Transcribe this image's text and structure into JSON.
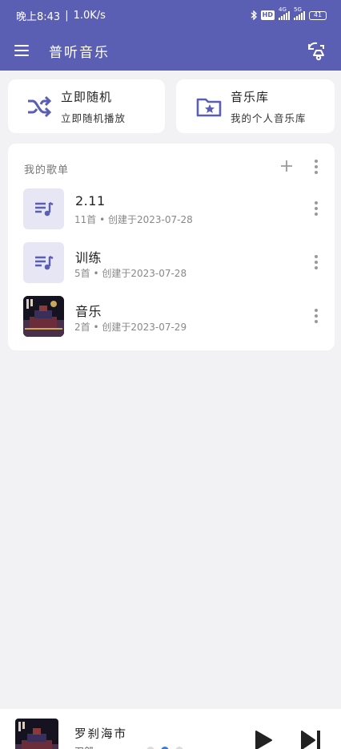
{
  "status_bar": {
    "time": "晚上8:43",
    "separator": "|",
    "speed": "1.0K/s",
    "network_1": "4G",
    "network_2": "5G",
    "battery": "41"
  },
  "app": {
    "title": "普听音乐"
  },
  "quick_actions": [
    {
      "title": "立即随机",
      "subtitle": "立即随机播放",
      "icon": "shuffle-icon"
    },
    {
      "title": "音乐库",
      "subtitle": "我的个人音乐库",
      "icon": "folder-star-icon"
    }
  ],
  "playlists": {
    "header": "我的歌单",
    "items": [
      {
        "name": "2.11",
        "meta": "11首 • 创建于2023-07-28",
        "cover": "playlist-icon"
      },
      {
        "name": "训练",
        "meta": "5首 • 创建于2023-07-28",
        "cover": "playlist-icon"
      },
      {
        "name": "音乐",
        "meta": "2首 • 创建于2023-07-29",
        "cover": "album-art"
      }
    ]
  },
  "now_playing": {
    "title": "罗刹海市",
    "artist": "刀郎"
  },
  "colors": {
    "primary": "#5b5fb3",
    "accent": "#3b7be0",
    "background": "#f2f2f4"
  }
}
